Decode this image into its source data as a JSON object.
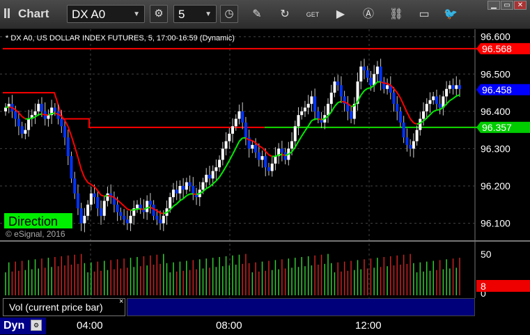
{
  "window": {
    "app_title": "Chart",
    "symbol_value": "DX A0",
    "interval_value": "5",
    "minimize": "▁",
    "restore": "▭",
    "close": "✕"
  },
  "toolbar": {
    "icons": [
      "gear-icon",
      "clock-icon",
      "pencil-icon",
      "refresh-icon",
      "get-icon",
      "play-icon",
      "alert-icon",
      "link-icon",
      "chat-icon",
      "twitter-icon"
    ]
  },
  "chart": {
    "legend": "* DX A0, US DOLLAR INDEX FUTURES, 5, 17:00-16:59 (Dynamic)",
    "watermark": "© eSignal, 2016",
    "direction_label": "Direction",
    "y_ticks": [
      "96.600",
      "96.500",
      "96.400",
      "96.300",
      "96.200",
      "96.100"
    ],
    "price_tags": [
      {
        "text": "96.568",
        "color": "#ff0000"
      },
      {
        "text": "96.458",
        "color": "#0000ff"
      },
      {
        "text": "96.357",
        "color": "#00cc00"
      }
    ],
    "vol_ticks": [
      "50",
      "0"
    ],
    "vol_tag": "8",
    "vol_label": "Vol (current price bar)",
    "vol_close": "×",
    "dyn_label": "Dyn",
    "time_labels": [
      "04:00",
      "08:00",
      "12:00"
    ]
  },
  "chart_data": {
    "type": "candlestick",
    "title": "* DX A0, US DOLLAR INDEX FUTURES, 5, 17:00-16:59 (Dynamic)",
    "ylim": [
      96.06,
      96.62
    ],
    "yticks": [
      96.6,
      96.5,
      96.4,
      96.3,
      96.2,
      96.1
    ],
    "xticks": [
      "04:00",
      "08:00",
      "12:00"
    ],
    "close": [
      96.41,
      96.42,
      96.4,
      96.38,
      96.36,
      96.34,
      96.35,
      96.38,
      96.39,
      96.4,
      96.42,
      96.4,
      96.38,
      96.39,
      96.41,
      96.4,
      96.38,
      96.36,
      96.33,
      96.28,
      96.22,
      96.18,
      96.14,
      96.1,
      96.12,
      96.15,
      96.18,
      96.17,
      96.14,
      96.12,
      96.16,
      96.18,
      96.17,
      96.15,
      96.13,
      96.12,
      96.11,
      96.1,
      96.12,
      96.14,
      96.15,
      96.14,
      96.13,
      96.16,
      96.15,
      96.12,
      96.11,
      96.1,
      96.12,
      96.14,
      96.17,
      96.19,
      96.18,
      96.2,
      96.19,
      96.21,
      96.2,
      96.18,
      96.17,
      96.19,
      96.21,
      96.23,
      96.22,
      96.24,
      96.25,
      96.27,
      96.3,
      96.32,
      96.34,
      96.36,
      96.38,
      96.4,
      96.37,
      96.33,
      96.3,
      96.31,
      96.29,
      96.27,
      96.28,
      96.25,
      96.24,
      96.26,
      96.28,
      96.3,
      96.29,
      96.27,
      96.3,
      96.32,
      96.36,
      96.39,
      96.4,
      96.41,
      96.42,
      96.44,
      96.4,
      96.38,
      96.37,
      96.39,
      96.42,
      96.45,
      96.48,
      96.47,
      96.44,
      96.42,
      96.4,
      96.38,
      96.42,
      96.48,
      96.52,
      96.51,
      96.49,
      96.47,
      96.5,
      96.52,
      96.48,
      96.46,
      96.47,
      96.45,
      96.42,
      96.4,
      96.37,
      96.33,
      96.31,
      96.3,
      96.32,
      96.35,
      96.38,
      96.4,
      96.42,
      96.43,
      96.44,
      96.42,
      96.41,
      96.44,
      96.46,
      96.47,
      96.46,
      96.47,
      96.46
    ],
    "volume_ylim": [
      0,
      60
    ],
    "volume_ticks": [
      50,
      0
    ],
    "series": [
      {
        "name": "96.568",
        "color": "#ff0000",
        "type": "reference-line"
      },
      {
        "name": "96.357",
        "color": "#00cc00",
        "type": "reference-line"
      }
    ]
  }
}
